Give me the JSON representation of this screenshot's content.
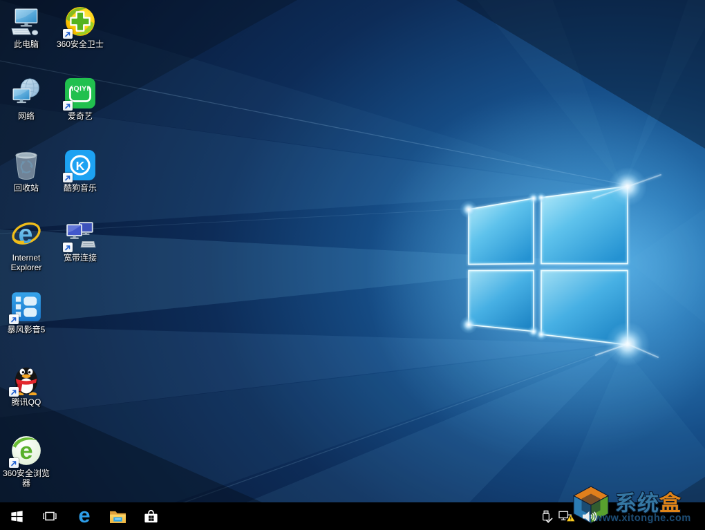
{
  "desktop": {
    "icons": [
      {
        "label": "此电脑",
        "icon": "this-pc-icon",
        "shortcut": false
      },
      {
        "label": "360安全卫士",
        "icon": "360-safety-guard-icon",
        "shortcut": true
      },
      {
        "label": "网络",
        "icon": "network-icon",
        "shortcut": false
      },
      {
        "label": "爱奇艺",
        "icon": "iqiyi-icon",
        "shortcut": true
      },
      {
        "label": "回收站",
        "icon": "recycle-bin-icon",
        "shortcut": false
      },
      {
        "label": "酷狗音乐",
        "icon": "kugou-music-icon",
        "shortcut": true
      },
      {
        "label": "Internet Explorer",
        "icon": "internet-explorer-icon",
        "shortcut": false
      },
      {
        "label": "宽带连接",
        "icon": "broadband-connection-icon",
        "shortcut": true
      },
      {
        "label": "暴风影音5",
        "icon": "baofeng-player-icon",
        "shortcut": true
      },
      {
        "label": "腾讯QQ",
        "icon": "tencent-qq-icon",
        "shortcut": true
      },
      {
        "label": "360安全浏览器",
        "icon": "360-browser-icon",
        "shortcut": true
      }
    ],
    "logo_text": {
      "iqiyi": "iQIYI",
      "kugou": "K",
      "ie": "e",
      "browser360": "e"
    }
  },
  "taskbar": {
    "edge_letter": "e",
    "buttons": [
      {
        "icon": "start-icon"
      },
      {
        "icon": "task-view-icon"
      },
      {
        "icon": "edge-icon"
      },
      {
        "icon": "file-explorer-icon"
      },
      {
        "icon": "store-icon"
      }
    ],
    "tray": [
      {
        "icon": "usb-safely-remove-icon"
      },
      {
        "icon": "network-warning-icon"
      },
      {
        "icon": "volume-icon"
      }
    ]
  },
  "watermark": {
    "title_blue": "系统",
    "title_orange": "盒",
    "url": "www.xitonghe.com"
  },
  "colors": {
    "wallpaper_dark": "#081527",
    "wallpaper_beam": "#7cc6f2",
    "logo_pane_light": "#b8ecfa",
    "logo_pane_deep": "#2492d2",
    "taskbar": "#000000",
    "edge_blue": "#2d9de8",
    "iqiyi_green": "#21c04e",
    "kugou_blue": "#1da2f2",
    "qq_red": "#e3262c",
    "warning_yellow": "#ffcf21",
    "watermark_blue": "#3577a3",
    "watermark_orange": "#e08418"
  }
}
